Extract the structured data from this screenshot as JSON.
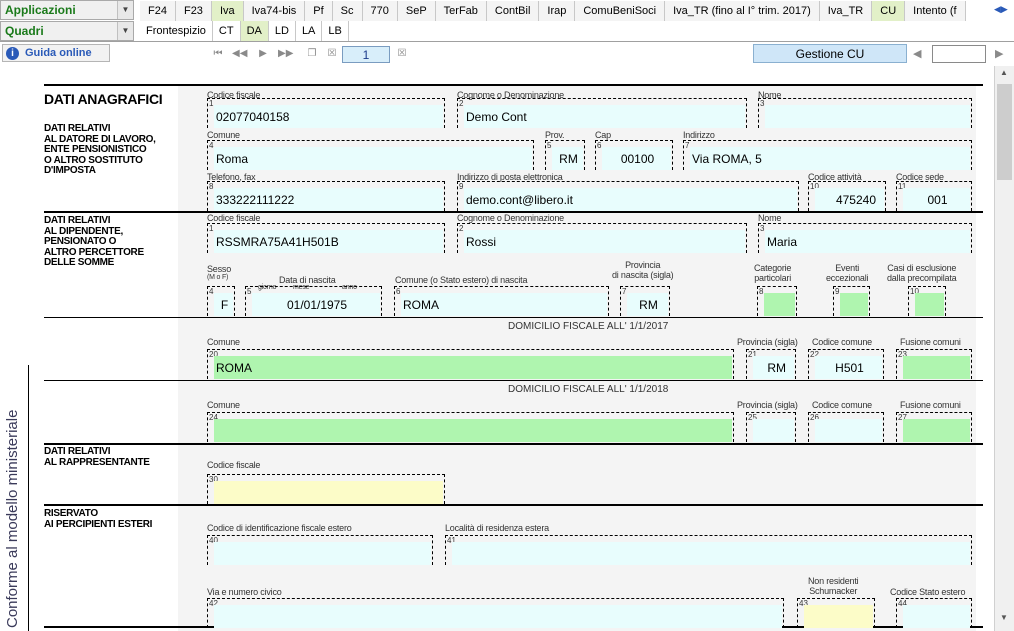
{
  "toolbar": {
    "applicazioni": "Applicazioni",
    "quadri": "Quadri",
    "guida": "Guida online",
    "page_number": "1",
    "gestione_cu": "Gestione CU",
    "search_value": ""
  },
  "top_tabs": [
    "F24",
    "F23",
    "Iva",
    "Iva74-bis",
    "Pf",
    "Sc",
    "770",
    "SeP",
    "TerFab",
    "ContBil",
    "Irap",
    "ComuBeniSoci",
    "Iva_TR (fino al I° trim. 2017)",
    "Iva_TR",
    "CU",
    "Intento (f"
  ],
  "sub_tabs": [
    "Frontespizio",
    "CT",
    "DA",
    "LD",
    "LA",
    "LB"
  ],
  "side_text": "Conforme al modello ministeriale",
  "sections": {
    "title": "DATI ANAGRAFICI",
    "datore": "DATI RELATIVI\nAL DATORE DI LAVORO,\nENTE PENSIONISTICO\nO ALTRO SOSTITUTO\nD'IMPOSTA",
    "dipendente": "DATI RELATIVI\nAL DIPENDENTE,\nPENSIONATO O\nALTRO PERCETTORE\nDELLE SOMME",
    "rappresentante": "DATI RELATIVI\nAL RAPPRESENTANTE",
    "esteri": "RISERVATO\nAI PERCIPIENTI ESTERI",
    "domicilio_2017": "DOMICILIO FISCALE ALL' 1/1/2017",
    "domicilio_2018": "DOMICILIO FISCALE ALL' 1/1/2018"
  },
  "labels": {
    "codice_fiscale": "Codice fiscale",
    "cognome": "Cognome o Denominazione",
    "nome": "Nome",
    "comune": "Comune",
    "prov": "Prov.",
    "cap": "Cap",
    "indirizzo": "Indirizzo",
    "telefono": "Telefono, fax",
    "email": "Indirizzo di posta elettronica",
    "codice_attivita": "Codice attività",
    "codice_sede": "Codice sede",
    "sesso": "Sesso",
    "sesso_mf": "(M o F)",
    "data_nascita": "Data di nascita",
    "giorno": "giorno",
    "mese": "mese",
    "anno": "anno",
    "comune_nascita": "Comune (o Stato estero) di nascita",
    "provincia_nascita": "Provincia\ndi nascita (sigla)",
    "categorie": "Categorie\nparticolari",
    "eventi": "Eventi\neccezionali",
    "casi": "Casi di esclusione\ndalla precompilata",
    "provincia_sigla": "Provincia (sigla)",
    "codice_comune": "Codice comune",
    "fusione": "Fusione comuni",
    "codice_fiscale_rapp": "Codice fiscale",
    "codice_estero": "Codice di identificazione fiscale estero",
    "localita_estera": "Località di residenza estera",
    "via": "Via e numero civico",
    "non_residenti": "Non residenti\nSchumacker",
    "codice_stato": "Codice Stato estero"
  },
  "values": {
    "datore_cf": "02077040158",
    "datore_cognome": "Demo Cont",
    "datore_nome": "",
    "datore_comune": "Roma",
    "datore_prov": "RM",
    "datore_cap": "00100",
    "datore_indirizzo": "Via ROMA, 5",
    "datore_telefono": "333222111222",
    "datore_email": "demo.cont@libero.it",
    "datore_attivita": "475240",
    "datore_sede": "001",
    "dip_cf": "RSSMRA75A41H501B",
    "dip_cognome": "Rossi",
    "dip_nome": "Maria",
    "dip_sesso": "F",
    "dip_data": "01/01/1975",
    "dip_comune_nascita": "ROMA",
    "dip_prov_nascita": "RM",
    "dom17_comune": "ROMA",
    "dom17_prov": "RM",
    "dom17_codice": "H501"
  },
  "colors": {
    "field_blue": "#e8fdfd",
    "field_green": "#aff5af",
    "field_yellow": "#fcfcc8",
    "form_bg": "#f4f4f4",
    "accent_blue": "#2a5ab8"
  }
}
